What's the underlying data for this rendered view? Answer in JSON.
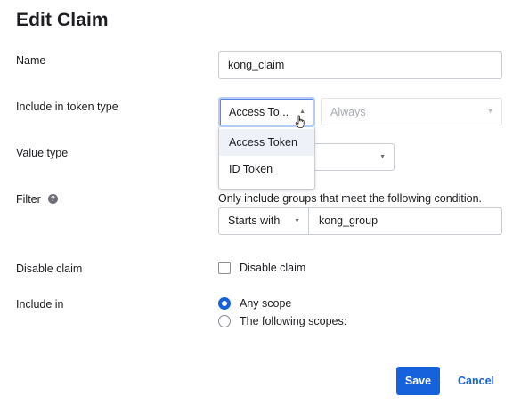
{
  "page": {
    "title": "Edit Claim"
  },
  "form": {
    "name": {
      "label": "Name",
      "value": "kong_claim"
    },
    "token_type": {
      "label": "Include in token type",
      "selected": "Access To...",
      "options": [
        "Access Token",
        "ID Token"
      ],
      "secondary_value": "Always"
    },
    "value_type": {
      "label": "Value type"
    },
    "filter": {
      "label": "Filter",
      "help_icon": "question-circle-icon",
      "description": "Only include groups that meet the following condition.",
      "operator": "Starts with",
      "value": "kong_group"
    },
    "disable_claim": {
      "label": "Disable claim",
      "checkbox_label": "Disable claim",
      "checked": false
    },
    "include_in": {
      "label": "Include in",
      "options": [
        {
          "label": "Any scope",
          "checked": true
        },
        {
          "label": "The following scopes:",
          "checked": false
        }
      ]
    }
  },
  "actions": {
    "save": "Save",
    "cancel": "Cancel"
  },
  "colors": {
    "accent": "#1662dd",
    "text": "#1d1d21",
    "border": "#c9ccd3"
  }
}
